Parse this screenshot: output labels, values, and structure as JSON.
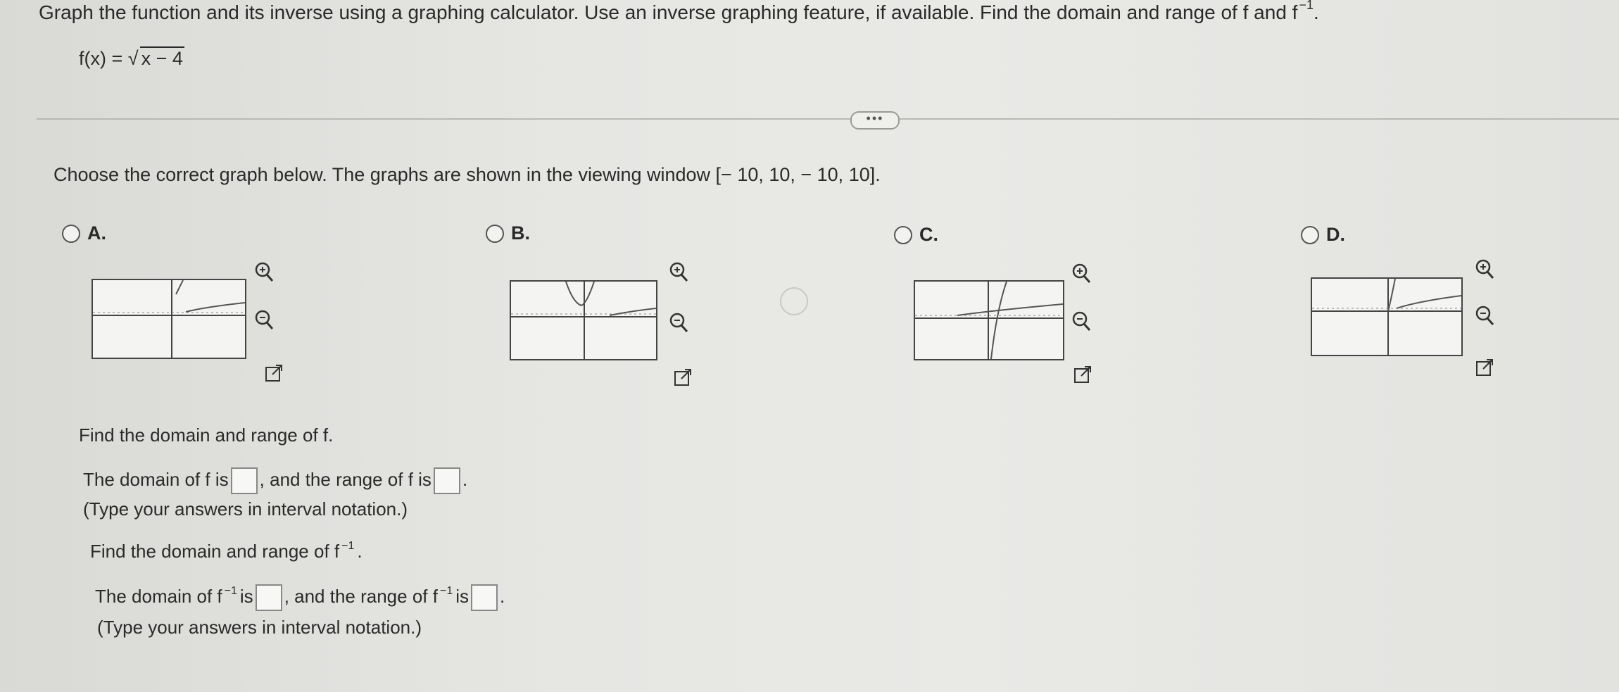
{
  "question": {
    "title": "Graph the function and its inverse using a graphing calculator. Use an inverse graphing feature, if available. Find the domain and range of f and f",
    "title_sup": "−1",
    "title_end": ".",
    "function_lhs": "f(x) = √",
    "function_radicand": "x − 4"
  },
  "more_button": "•••",
  "instruction": "Choose the correct graph below. The graphs are shown in the viewing window [− 10, 10, − 10, 10].",
  "options": [
    {
      "label": "A."
    },
    {
      "label": "B."
    },
    {
      "label": "C."
    },
    {
      "label": "D."
    }
  ],
  "icons": {
    "zoom_in": "zoom-in-icon",
    "zoom_out": "zoom-out-icon",
    "expand": "expand-icon"
  },
  "part_f": {
    "prompt": "Find the domain and range of f.",
    "domain_text": "The domain of f is",
    "range_text": ", and the range of f is",
    "end": ".",
    "hint": "(Type your answers in interval notation.)"
  },
  "part_finv": {
    "prompt": "Find the domain and range of f",
    "prompt_sup": "−1",
    "prompt_end": ".",
    "domain_text": "The domain of f",
    "domain_sup": "−1",
    "is1": "is",
    "range_text": ", and the range of f",
    "range_sup": "−1",
    "is2": "is",
    "end": ".",
    "hint": "(Type your answers in interval notation.)"
  },
  "colors": {
    "text": "#2a2a2a",
    "graph_line": "#555555",
    "axis": "#444444"
  }
}
